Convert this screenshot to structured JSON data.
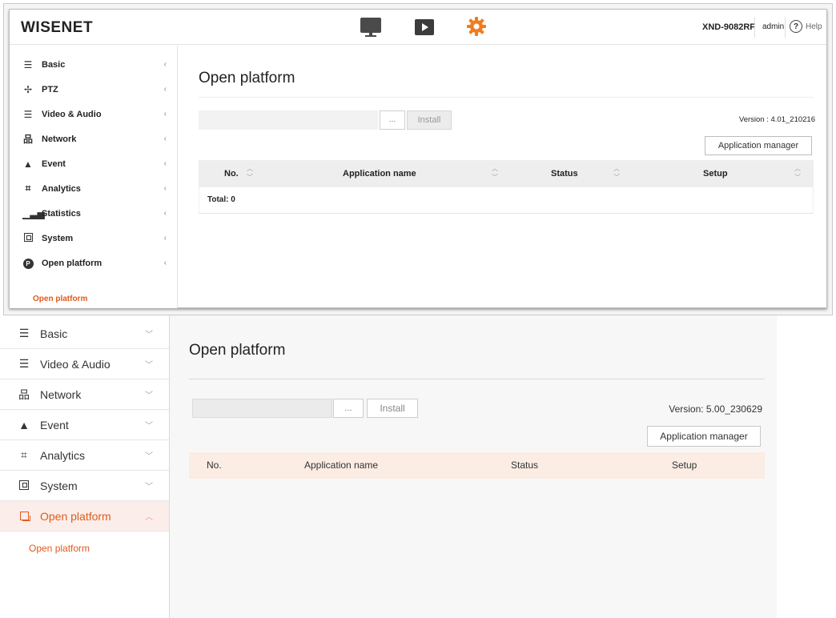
{
  "top": {
    "header": {
      "logo": "WISENET",
      "model": "XND-9082RF",
      "user": "admin",
      "help": "Help",
      "icons": [
        "monitor-icon",
        "play-icon",
        "gear-icon",
        "help-icon"
      ],
      "accent_color": "#f07c1f"
    },
    "sidebar": {
      "items": [
        {
          "label": "Basic",
          "icon": "list-icon"
        },
        {
          "label": "PTZ",
          "icon": "move-icon"
        },
        {
          "label": "Video & Audio",
          "icon": "sliders-icon"
        },
        {
          "label": "Network",
          "icon": "network-icon"
        },
        {
          "label": "Event",
          "icon": "bell-icon"
        },
        {
          "label": "Analytics",
          "icon": "frame-icon"
        },
        {
          "label": "Statistics",
          "icon": "bar-chart-icon"
        },
        {
          "label": "System",
          "icon": "system-icon"
        },
        {
          "label": "Open platform",
          "icon": "platform-icon"
        }
      ],
      "sub_item": "Open platform",
      "chevron": "‹"
    },
    "main": {
      "title": "Open platform",
      "browse_label": "...",
      "install_label": "Install",
      "version": "Version : 4.01_210216",
      "app_manager_label": "Application manager",
      "columns": [
        "No.",
        "Application name",
        "Status",
        "Setup"
      ],
      "total": "Total: 0"
    }
  },
  "bottom": {
    "sidebar": {
      "items": [
        {
          "label": "Basic",
          "icon": "list-icon"
        },
        {
          "label": "Video & Audio",
          "icon": "sliders-icon"
        },
        {
          "label": "Network",
          "icon": "network-icon"
        },
        {
          "label": "Event",
          "icon": "bell-icon"
        },
        {
          "label": "Analytics",
          "icon": "frame-icon"
        },
        {
          "label": "System",
          "icon": "system-icon"
        },
        {
          "label": "Open platform",
          "icon": "platform-icon",
          "active": true
        }
      ],
      "sub_item": "Open platform",
      "active_color": "#e05a1c",
      "active_bg": "#fbeeea"
    },
    "main": {
      "title": "Open platform",
      "browse_label": "...",
      "install_label": "Install",
      "version": "Version: 5.00_230629",
      "app_manager_label": "Application manager",
      "columns": [
        "No.",
        "Application name",
        "Status",
        "Setup"
      ]
    }
  }
}
